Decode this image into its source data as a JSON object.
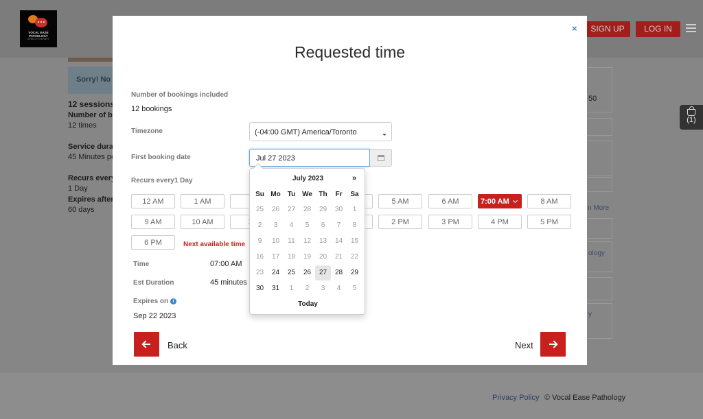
{
  "header": {
    "logo_line1": "VOCAL EASE",
    "logo_line2": "PATHOLOGY",
    "logo_line3": "SPEECH THERAPY",
    "signup_label": "SIGN UP",
    "login_label": "LOG IN",
    "cart_count": "(1)"
  },
  "background": {
    "alert": "Sorry! No s",
    "sessions": "12 sessions",
    "num_bookings_label": "Number of bo",
    "num_bookings_value": "12 times",
    "service_label": "Service dura",
    "service_value": "45 Minutes pe",
    "recurs_label": "Recurs every",
    "recurs_value": "1 Day",
    "expires_label": "Expires after",
    "expires_value": "60 days",
    "right_price": "50",
    "right_more": "n More",
    "right_ology": "ology",
    "right_y": "y"
  },
  "footer": {
    "privacy": "Privacy Policy",
    "copyright": "© Vocal Ease Pathology"
  },
  "modal": {
    "close": "×",
    "title": "Requested time",
    "bookings_label": "Number of bookings included",
    "bookings_value": "12 bookings",
    "timezone_label": "Timezone",
    "timezone_value": "(-04:00 GMT) America/Toronto",
    "first_date_label": "First booking date",
    "first_date_value": "Jul 27 2023",
    "recurs_label": "Recurs every1 Day",
    "slots_row1": [
      "12 AM",
      "1 AM",
      "2",
      "",
      "5 AM",
      "6 AM",
      "7:00 AM",
      "8 AM"
    ],
    "slots_row2": [
      "9 AM",
      "10 AM",
      "11",
      "",
      "2 PM",
      "3 PM",
      "4 PM",
      "5 PM"
    ],
    "slot_6pm": "6 PM",
    "next_available": "Next available time",
    "time_label": "Time",
    "time_value": "07:00 AM",
    "duration_label": "Est Duration",
    "duration_value": "45 minutes",
    "expires_label": "Expires on",
    "expires_value": "Sep 22 2023",
    "back_label": "Back",
    "next_label": "Next"
  },
  "datepicker": {
    "month": "July 2023",
    "next": "»",
    "dow": [
      "Su",
      "Mo",
      "Tu",
      "We",
      "Th",
      "Fr",
      "Sa"
    ],
    "weeks": [
      [
        "25",
        "26",
        "27",
        "28",
        "29",
        "30",
        "1"
      ],
      [
        "2",
        "3",
        "4",
        "5",
        "6",
        "7",
        "8"
      ],
      [
        "9",
        "10",
        "11",
        "12",
        "13",
        "14",
        "15"
      ],
      [
        "16",
        "17",
        "18",
        "19",
        "20",
        "21",
        "22"
      ],
      [
        "23",
        "24",
        "25",
        "26",
        "27",
        "28",
        "29"
      ],
      [
        "30",
        "31",
        "1",
        "2",
        "3",
        "4",
        "5"
      ]
    ],
    "today": "Today"
  },
  "colors": {
    "accent": "#c8211d",
    "link": "#3a87c8"
  }
}
